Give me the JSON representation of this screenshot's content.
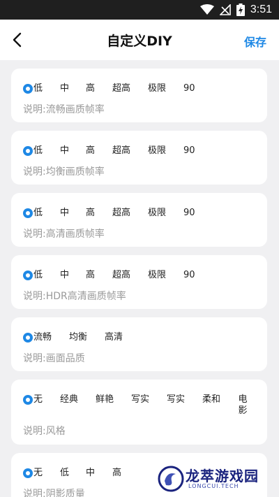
{
  "status_bar": {
    "time": "3:51"
  },
  "header": {
    "title": "自定义DIY",
    "save_label": "保存"
  },
  "cards": [
    {
      "options": [
        "低",
        "中",
        "高",
        "超高",
        "极限",
        "90"
      ],
      "selected": 0,
      "description": "说明:流畅画质帧率"
    },
    {
      "options": [
        "低",
        "中",
        "高",
        "超高",
        "极限",
        "90"
      ],
      "selected": 0,
      "description": "说明:均衡画质帧率"
    },
    {
      "options": [
        "低",
        "中",
        "高",
        "超高",
        "极限",
        "90"
      ],
      "selected": 0,
      "description": "说明:高清画质帧率"
    },
    {
      "options": [
        "低",
        "中",
        "高",
        "超高",
        "极限",
        "90"
      ],
      "selected": 0,
      "description": "说明:HDR高清画质帧率"
    },
    {
      "options": [
        "流畅",
        "均衡",
        "高清"
      ],
      "selected": 0,
      "description": "说明:画面品质"
    },
    {
      "options": [
        "无",
        "经典",
        "鲜艳",
        "写实",
        "写实",
        "柔和",
        "电影"
      ],
      "selected": 0,
      "description": "说明:风格"
    },
    {
      "options": [
        "无",
        "低",
        "中",
        "高"
      ],
      "selected": 0,
      "description": "说明:阴影质量"
    }
  ],
  "watermark": {
    "text": "龙萃游戏园",
    "sub": "LONGCUI.TECH"
  },
  "colors": {
    "accent": "#1e88e5",
    "background": "#f0f0f2"
  }
}
